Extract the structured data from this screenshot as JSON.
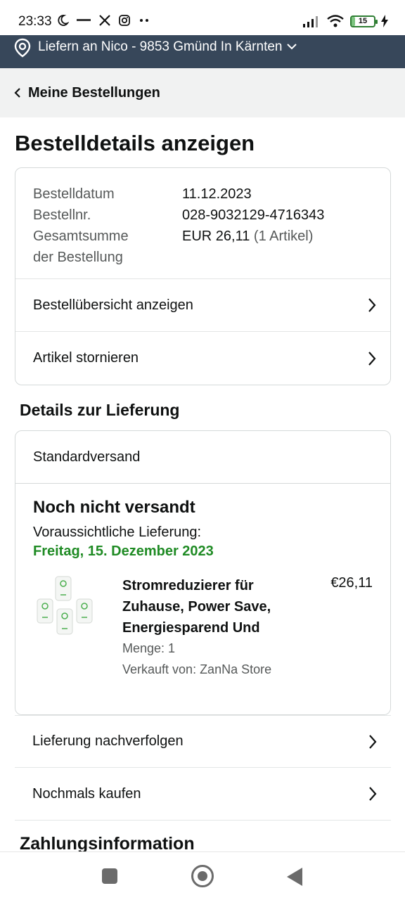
{
  "status_bar": {
    "time": "23:33",
    "battery": "15",
    "battery_level": 0.15
  },
  "location_bar": {
    "text": "Liefern an Nico - 9853 Gmünd In Kärnten"
  },
  "nav_header": {
    "back_label": "Meine Bestellungen"
  },
  "page_title": "Bestelldetails anzeigen",
  "order_info": {
    "date_label": "Bestelldatum",
    "date_value": "11.12.2023",
    "number_label": "Bestellnr.",
    "number_value": "028-9032129-4716343",
    "total_label_line1": "Gesamtsumme",
    "total_label_line2": "der Bestellung",
    "total_value": "EUR 26,11",
    "total_items": "(1 Artikel)"
  },
  "order_links": {
    "overview": "Bestellübersicht anzeigen",
    "cancel": "Artikel stornieren"
  },
  "delivery": {
    "section_title": "Details zur Lieferung",
    "method": "Standardversand",
    "status": "Noch nicht versandt",
    "eta_label": "Voraussichtliche Lieferung:",
    "eta_date": "Freitag, 15. Dezember 2023",
    "item": {
      "title": "Stromreduzierer für Zuhause, Power Save, Energiesparend Und",
      "price": "€26,11",
      "quantity": "Menge: 1",
      "seller": "Verkauft von: ZanNa Store"
    },
    "track_label": "Lieferung nachverfolgen",
    "buy_again_label": "Nochmals kaufen"
  },
  "payment": {
    "section_title": "Zahlungsinformation"
  },
  "colors": {
    "header_bg": "#37475a",
    "eta_green": "#1f8b24",
    "nav_bg": "#f1f2f2"
  }
}
